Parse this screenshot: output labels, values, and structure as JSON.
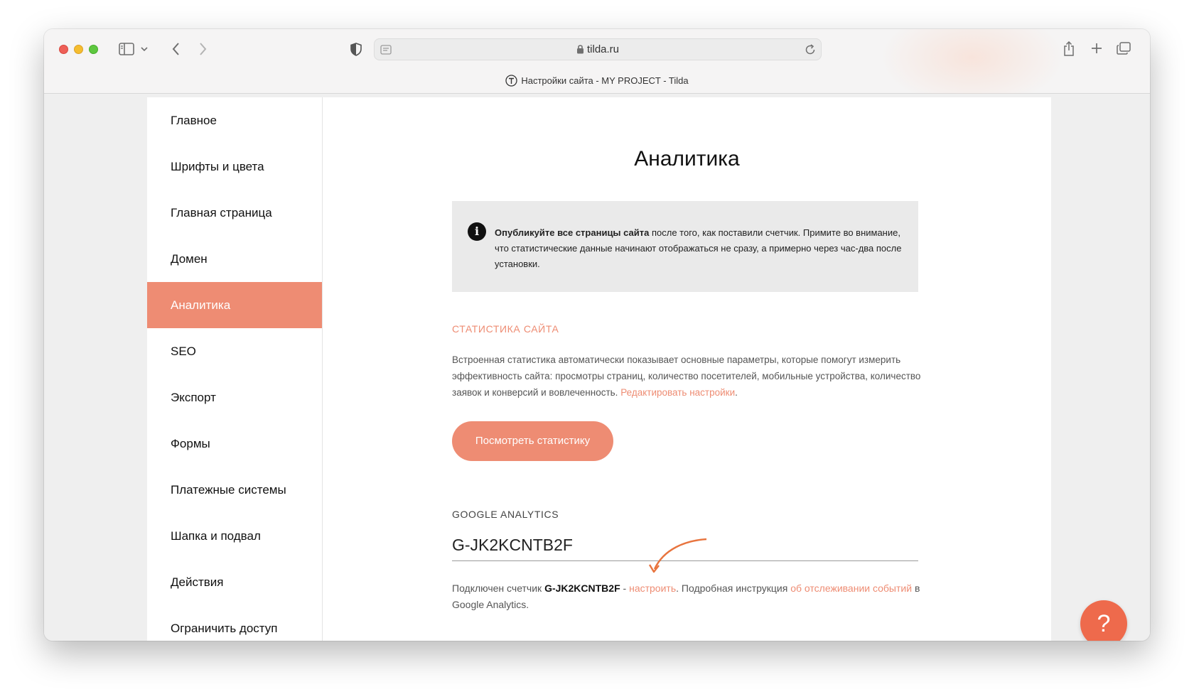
{
  "browser": {
    "url": "tilda.ru",
    "tab_title": "Настройки сайта - MY PROJECT - Tilda"
  },
  "sidebar": {
    "items": [
      {
        "label": "Главное"
      },
      {
        "label": "Шрифты и цвета"
      },
      {
        "label": "Главная страница"
      },
      {
        "label": "Домен"
      },
      {
        "label": "Аналитика",
        "active": true
      },
      {
        "label": "SEO"
      },
      {
        "label": "Экспорт"
      },
      {
        "label": "Формы"
      },
      {
        "label": "Платежные системы"
      },
      {
        "label": "Шапка и подвал"
      },
      {
        "label": "Действия"
      },
      {
        "label": "Ограничить доступ"
      }
    ]
  },
  "main": {
    "title": "Аналитика",
    "notice": {
      "bold": "Опубликуйте все страницы сайта",
      "text": " после того, как поставили счетчик. Примите во внимание, что статистические данные начинают отображаться не сразу, а примерно через час-два после установки."
    },
    "stats": {
      "title": "СТАТИСТИКА САЙТА",
      "description": "Встроенная статистика автоматически показывает основные параметры, которые помогут измерить эффективность сайта: просмотры страниц, количество посетителей, мобильные устройства, количество заявок и конверсий и вовлеченность.",
      "edit_link": "Редактировать настройки",
      "edit_link_suffix": ".",
      "button": "Посмотреть статистику"
    },
    "ga": {
      "title": "GOOGLE ANALYTICS",
      "value": "G-JK2KCNTB2F",
      "note_prefix": "Подключен счетчик ",
      "note_id": "G-JK2KCNTB2F",
      "note_dash": " - ",
      "configure_link": "настроить",
      "note_middle": ". Подробная инструкция ",
      "events_link": "об отслеживании событий",
      "note_suffix": " в Google Analytics."
    }
  },
  "help": {
    "label": "?"
  },
  "colors": {
    "accent": "#ee8c73",
    "help_button": "#ee6a4c",
    "notice_bg": "#eaeaea",
    "annotation_arrow": "#e8743e"
  },
  "icons": [
    "sidebar-toggle-icon",
    "chevron-down-icon",
    "back-icon",
    "forward-icon",
    "shield-icon",
    "reader-icon",
    "lock-icon",
    "reload-icon",
    "share-icon",
    "new-tab-icon",
    "tabs-overview-icon",
    "tilda-favicon-icon",
    "info-icon"
  ]
}
